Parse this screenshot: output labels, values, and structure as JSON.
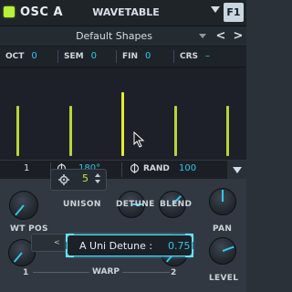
{
  "header": {
    "osc_label": "OSC A",
    "wavetable_title": "WAVETABLE",
    "f_button": "F1"
  },
  "preset": {
    "name": "Default Shapes",
    "prev": "<",
    "next": ">"
  },
  "params": {
    "oct_label": "OCT",
    "oct_value": "0",
    "sem_label": "SEM",
    "sem_value": "0",
    "fin_label": "FIN",
    "fin_value": "0",
    "crs_label": "CRS",
    "crs_value": "–"
  },
  "display": {
    "bars_color": "#b7d53a",
    "highlight_color": "#e3ea36"
  },
  "info": {
    "wt_position": "1",
    "phase_value": "180°",
    "rand_label": "RAND",
    "rand_value": "100"
  },
  "controls": {
    "wt_pos_label": "WT POS",
    "unison_label": "UNISON",
    "unison_value": "5",
    "detune_label": "DETUNE",
    "blend_label": "BLEND",
    "pan_label": "PAN",
    "level_label": "LEVEL",
    "warp_label": "WARP",
    "warp_left_num": "1",
    "warp_right_num": "2",
    "warp_nav_left": "<",
    "warp_nav_right": ">"
  },
  "tooltip": {
    "label": "A Uni Detune :",
    "value": "0.75"
  },
  "colors": {
    "accent": "#2fc8e8",
    "active_green": "#b7f23a"
  }
}
